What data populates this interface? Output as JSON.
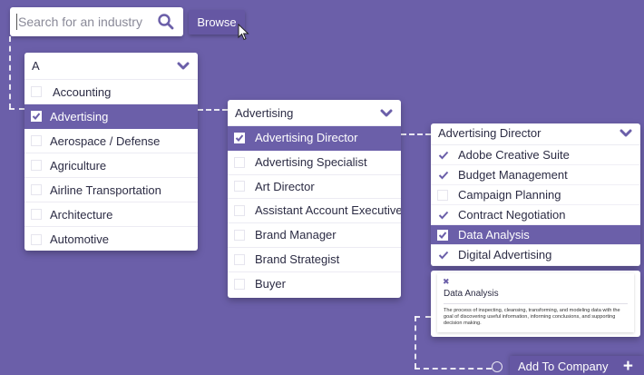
{
  "search": {
    "placeholder": "Search for an industry"
  },
  "browse_label": "Browse",
  "industries": {
    "header": "A",
    "items": [
      {
        "label": "Accounting",
        "selected": false
      },
      {
        "label": "Advertising",
        "selected": true
      },
      {
        "label": "Aerospace / Defense",
        "selected": false
      },
      {
        "label": "Agriculture",
        "selected": false
      },
      {
        "label": "Airline Transportation",
        "selected": false
      },
      {
        "label": "Architecture",
        "selected": false
      },
      {
        "label": "Automotive",
        "selected": false
      }
    ]
  },
  "roles": {
    "header": "Advertising",
    "items": [
      {
        "label": "Advertising Director",
        "selected": true
      },
      {
        "label": "Advertising Specialist",
        "selected": false
      },
      {
        "label": "Art Director",
        "selected": false
      },
      {
        "label": "Assistant Account Executive",
        "selected": false
      },
      {
        "label": "Brand Manager",
        "selected": false
      },
      {
        "label": "Brand Strategist",
        "selected": false
      },
      {
        "label": "Buyer",
        "selected": false
      }
    ]
  },
  "skills": {
    "header": "Advertising Director",
    "items": [
      {
        "label": "Adobe Creative Suite",
        "checked": true,
        "highlighted": false
      },
      {
        "label": "Budget Management",
        "checked": true,
        "highlighted": false
      },
      {
        "label": "Campaign Planning",
        "checked": false,
        "highlighted": false
      },
      {
        "label": "Contract Negotiation",
        "checked": true,
        "highlighted": false
      },
      {
        "label": "Data Analysis",
        "checked": true,
        "highlighted": true
      },
      {
        "label": "Digital Advertising",
        "checked": true,
        "highlighted": false
      }
    ]
  },
  "detail": {
    "title": "Data Analysis",
    "description": "The process of inspecting, cleansing, transforming, and modeling data with the goal of discovering useful information, informing conclusions, and supporting decision making."
  },
  "add_button_label": "Add To Company",
  "colors": {
    "background": "#6b5fa9",
    "accent": "#6b5fa9",
    "button": "#6557a3",
    "text": "#2c2c44"
  }
}
